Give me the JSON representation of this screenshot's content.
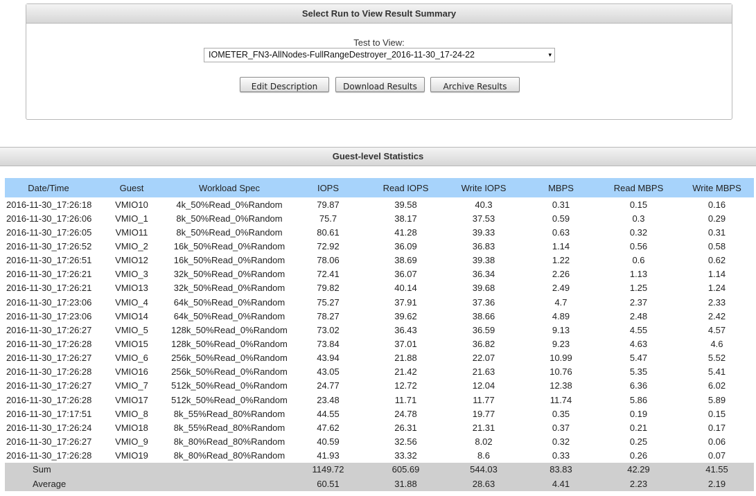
{
  "selector": {
    "header": "Select Run to View Result Summary",
    "label": "Test to View:",
    "selected": "IOMETER_FN3-AllNodes-FullRangeDestroyer_2016-11-30_17-24-22",
    "arrow": "▾",
    "buttons": {
      "edit": "Edit Description",
      "download": "Download Results",
      "archive": "Archive Results"
    }
  },
  "stats": {
    "header": "Guest-level Statistics",
    "columns": [
      "Date/Time",
      "Guest",
      "Workload Spec",
      "IOPS",
      "Read IOPS",
      "Write IOPS",
      "MBPS",
      "Read MBPS",
      "Write MBPS"
    ],
    "rows": [
      [
        "2016-11-30_17:26:18",
        "VMIO10",
        "4k_50%Read_0%Random",
        "79.87",
        "39.58",
        "40.3",
        "0.31",
        "0.15",
        "0.16"
      ],
      [
        "2016-11-30_17:26:06",
        "VMIO_1",
        "8k_50%Read_0%Random",
        "75.7",
        "38.17",
        "37.53",
        "0.59",
        "0.3",
        "0.29"
      ],
      [
        "2016-11-30_17:26:05",
        "VMIO11",
        "8k_50%Read_0%Random",
        "80.61",
        "41.28",
        "39.33",
        "0.63",
        "0.32",
        "0.31"
      ],
      [
        "2016-11-30_17:26:52",
        "VMIO_2",
        "16k_50%Read_0%Random",
        "72.92",
        "36.09",
        "36.83",
        "1.14",
        "0.56",
        "0.58"
      ],
      [
        "2016-11-30_17:26:51",
        "VMIO12",
        "16k_50%Read_0%Random",
        "78.06",
        "38.69",
        "39.38",
        "1.22",
        "0.6",
        "0.62"
      ],
      [
        "2016-11-30_17:26:21",
        "VMIO_3",
        "32k_50%Read_0%Random",
        "72.41",
        "36.07",
        "36.34",
        "2.26",
        "1.13",
        "1.14"
      ],
      [
        "2016-11-30_17:26:21",
        "VMIO13",
        "32k_50%Read_0%Random",
        "79.82",
        "40.14",
        "39.68",
        "2.49",
        "1.25",
        "1.24"
      ],
      [
        "2016-11-30_17:23:06",
        "VMIO_4",
        "64k_50%Read_0%Random",
        "75.27",
        "37.91",
        "37.36",
        "4.7",
        "2.37",
        "2.33"
      ],
      [
        "2016-11-30_17:23:06",
        "VMIO14",
        "64k_50%Read_0%Random",
        "78.27",
        "39.62",
        "38.66",
        "4.89",
        "2.48",
        "2.42"
      ],
      [
        "2016-11-30_17:26:27",
        "VMIO_5",
        "128k_50%Read_0%Random",
        "73.02",
        "36.43",
        "36.59",
        "9.13",
        "4.55",
        "4.57"
      ],
      [
        "2016-11-30_17:26:28",
        "VMIO15",
        "128k_50%Read_0%Random",
        "73.84",
        "37.01",
        "36.82",
        "9.23",
        "4.63",
        "4.6"
      ],
      [
        "2016-11-30_17:26:27",
        "VMIO_6",
        "256k_50%Read_0%Random",
        "43.94",
        "21.88",
        "22.07",
        "10.99",
        "5.47",
        "5.52"
      ],
      [
        "2016-11-30_17:26:28",
        "VMIO16",
        "256k_50%Read_0%Random",
        "43.05",
        "21.42",
        "21.63",
        "10.76",
        "5.35",
        "5.41"
      ],
      [
        "2016-11-30_17:26:27",
        "VMIO_7",
        "512k_50%Read_0%Random",
        "24.77",
        "12.72",
        "12.04",
        "12.38",
        "6.36",
        "6.02"
      ],
      [
        "2016-11-30_17:26:28",
        "VMIO17",
        "512k_50%Read_0%Random",
        "23.48",
        "11.71",
        "11.77",
        "11.74",
        "5.86",
        "5.89"
      ],
      [
        "2016-11-30_17:17:51",
        "VMIO_8",
        "8k_55%Read_80%Random",
        "44.55",
        "24.78",
        "19.77",
        "0.35",
        "0.19",
        "0.15"
      ],
      [
        "2016-11-30_17:26:24",
        "VMIO18",
        "8k_55%Read_80%Random",
        "47.62",
        "26.31",
        "21.31",
        "0.37",
        "0.21",
        "0.17"
      ],
      [
        "2016-11-30_17:26:27",
        "VMIO_9",
        "8k_80%Read_80%Random",
        "40.59",
        "32.56",
        "8.02",
        "0.32",
        "0.25",
        "0.06"
      ],
      [
        "2016-11-30_17:26:28",
        "VMIO19",
        "8k_80%Read_80%Random",
        "41.93",
        "33.32",
        "8.6",
        "0.33",
        "0.26",
        "0.07"
      ]
    ],
    "footer": [
      [
        "Sum",
        "",
        "",
        "1149.72",
        "605.69",
        "544.03",
        "83.83",
        "42.29",
        "41.55"
      ],
      [
        "Average",
        "",
        "",
        "60.51",
        "31.88",
        "28.63",
        "4.41",
        "2.23",
        "2.19"
      ]
    ]
  },
  "colors": {
    "table_header_bg": "#a7d3fb",
    "footer_bg": "#cfcfcf"
  }
}
